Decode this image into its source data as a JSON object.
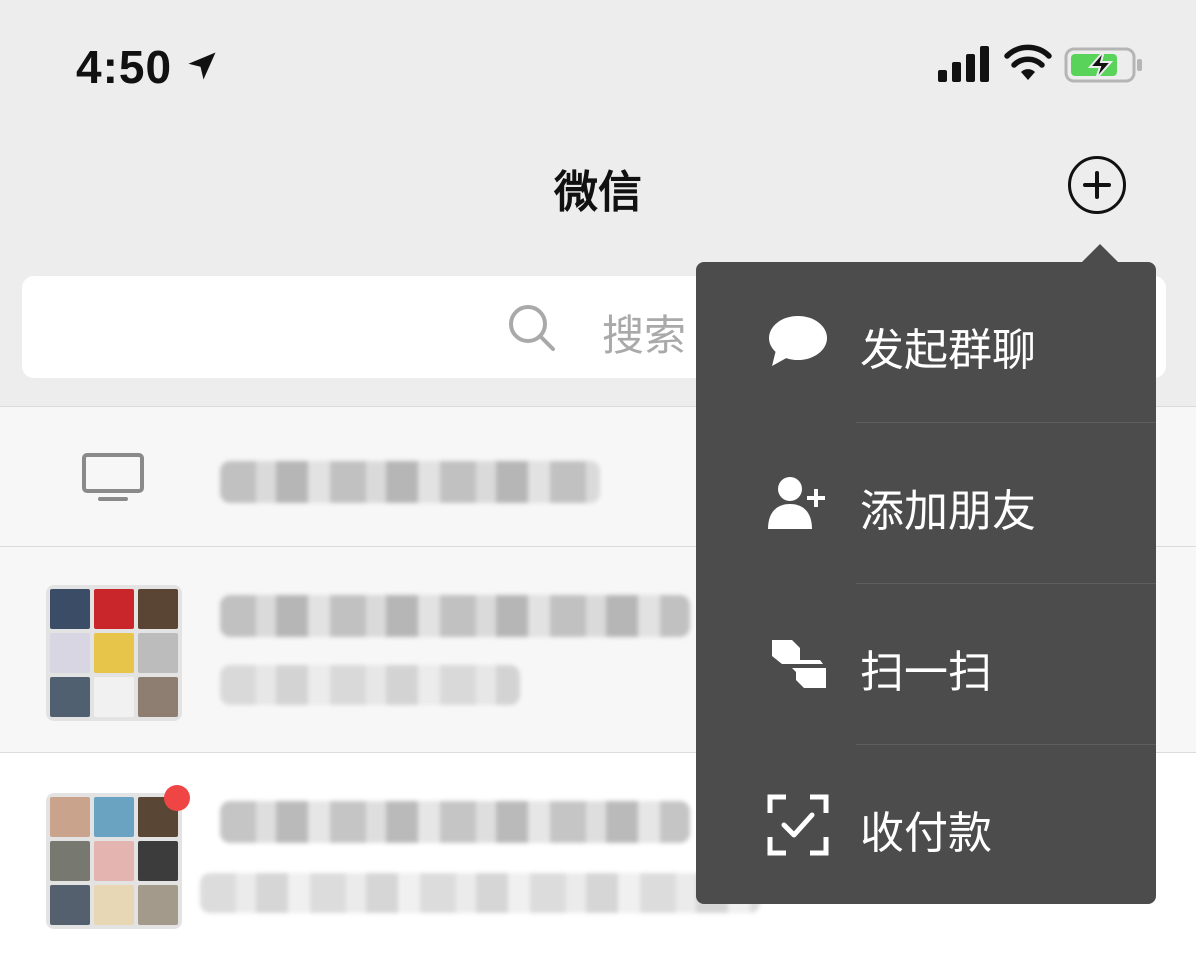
{
  "status_bar": {
    "time": "4:50",
    "icons": [
      "location-arrow-icon",
      "signal-icon",
      "wifi-icon",
      "battery-charging-icon"
    ],
    "battery_color": "#5ad35a"
  },
  "nav": {
    "title": "微信",
    "add_icon": "plus-circle-icon"
  },
  "search": {
    "placeholder": "搜索",
    "icon": "search-icon"
  },
  "chat_list": {
    "rows": [
      {
        "type": "device",
        "icon": "desktop-monitor-icon",
        "text": "(redacted)"
      },
      {
        "type": "group",
        "avatar": "group-avatar-grid",
        "text": "(redacted)",
        "unread_badge": false
      },
      {
        "type": "group",
        "avatar": "group-avatar-grid",
        "text": "(redacted)",
        "unread_badge": true
      }
    ],
    "badge_color": "#f04545"
  },
  "popup_menu": {
    "background": "#4c4c4c",
    "items": [
      {
        "label": "发起群聊",
        "icon": "chat-bubble-icon"
      },
      {
        "label": "添加朋友",
        "icon": "add-friend-icon"
      },
      {
        "label": "扫一扫",
        "icon": "scan-icon"
      },
      {
        "label": "收付款",
        "icon": "payment-check-icon"
      }
    ]
  }
}
